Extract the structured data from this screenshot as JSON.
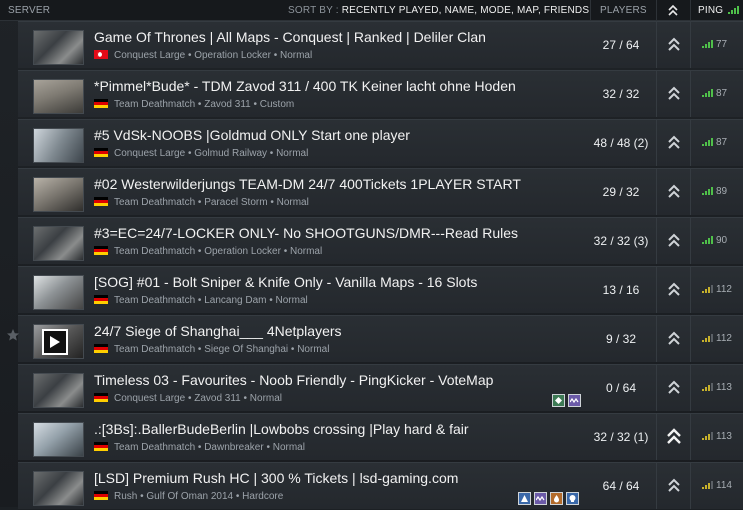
{
  "header": {
    "server": "SERVER",
    "sort_by_label": "SORT BY :",
    "sort_options": "RECENTLY PLAYED, NAME, MODE, MAP, FRIENDS",
    "players": "PLAYERS",
    "ping": "PING"
  },
  "colors": {
    "ping_good": "#4fc04a",
    "ping_ok": "#c7b12b",
    "row_bg": "#2a2f34",
    "header_bg": "#16191c"
  },
  "servers": [
    {
      "name": "Game Of Thrones | All Maps - Conquest | Ranked | Deliler Clan",
      "flag": "tr",
      "sub": "Conquest Large • Operation Locker • Normal",
      "players": "27 / 64",
      "ping": "77",
      "ping_quality": "good",
      "rank_icon": "rank-chevrons-icon"
    },
    {
      "name": "*Pimmel*Bude* - TDM Zavod 311 / 400 TK Keiner lacht ohne Hoden",
      "flag": "de",
      "sub": "Team Deathmatch • Zavod 311 • Custom",
      "players": "32 / 32",
      "ping": "87",
      "ping_quality": "good",
      "rank_icon": "rank-chevrons-icon"
    },
    {
      "name": "#5 VdSk-NOOBS |Goldmud ONLY Start one player",
      "flag": "de",
      "sub": "Conquest Large • Golmud Railway • Normal",
      "players": "48 / 48 (2)",
      "ping": "87",
      "ping_quality": "good",
      "rank_icon": "rank-chevrons-icon"
    },
    {
      "name": "#02 Westerwilderjungs TEAM-DM 24/7 400Tickets 1PLAYER START",
      "flag": "de",
      "sub": "Team Deathmatch • Paracel Storm • Normal",
      "players": "29 / 32",
      "ping": "89",
      "ping_quality": "good",
      "rank_icon": "rank-chevrons-icon"
    },
    {
      "name": "#3=EC=24/7-LOCKER ONLY- No SHOOTGUNS/DMR---Read Rules",
      "flag": "de",
      "sub": "Team Deathmatch • Operation Locker • Normal",
      "players": "32 / 32 (3)",
      "ping": "90",
      "ping_quality": "good",
      "rank_icon": "rank-chevrons-icon"
    },
    {
      "name": "[SOG] #01 - Bolt Sniper & Knife Only - Vanilla Maps - 16 Slots",
      "flag": "de",
      "sub": "Team Deathmatch • Lancang Dam • Normal",
      "players": "13 / 16",
      "ping": "112",
      "ping_quality": "ok",
      "rank_icon": "rank-chevrons-icon"
    },
    {
      "name": "24/7 Siege of Shanghai___ 4Netplayers",
      "flag": "de",
      "sub": "Team Deathmatch • Siege Of Shanghai • Normal",
      "players": "9 / 32",
      "ping": "112",
      "ping_quality": "ok",
      "rank_icon": "rank-chevrons-icon"
    },
    {
      "name": "Timeless 03 - Favourites - Noob Friendly - PingKicker - VoteMap",
      "flag": "de",
      "sub": "Conquest Large • Zavod 311 • Normal",
      "players": "0 / 64",
      "ping": "113",
      "ping_quality": "ok",
      "rank_icon": "rank-chevrons-icon"
    },
    {
      "name": ".:[3Bs]:.BallerBudeBerlin |Lowbobs crossing |Play hard & fair",
      "flag": "de",
      "sub": "Team Deathmatch • Dawnbreaker • Normal",
      "players": "32 / 32 (1)",
      "ping": "113",
      "ping_quality": "ok",
      "rank_icon": "rank-double-chevron-icon"
    },
    {
      "name": "[LSD] Premium Rush HC | 300 % Tickets | lsd-gaming.com",
      "flag": "de",
      "sub": "Rush • Gulf Of Oman 2014 • Hardcore",
      "players": "64 / 64",
      "ping": "114",
      "ping_quality": "ok",
      "rank_icon": "rank-chevrons-icon"
    }
  ]
}
